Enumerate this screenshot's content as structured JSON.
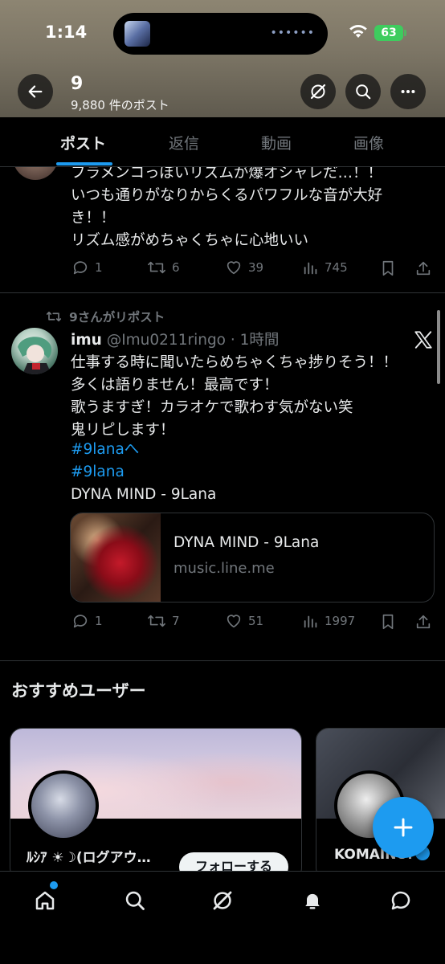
{
  "status_bar": {
    "time": "1:14",
    "battery": "63"
  },
  "header": {
    "name": "9",
    "post_count": "9,880 件のポスト"
  },
  "tabs": [
    {
      "label": "ポスト",
      "active": true
    },
    {
      "label": "返信",
      "active": false
    },
    {
      "label": "動画",
      "active": false
    },
    {
      "label": "画像",
      "active": false
    }
  ],
  "post1": {
    "text": "フラメンコっぽいリズムが爆オシャレだ…！！\nいつも通りがなりからくるパワフルな音が大好\nき！！\nリズム感がめちゃくちゃに心地いい",
    "replies": "1",
    "reposts": "6",
    "likes": "39",
    "views": "745"
  },
  "post2": {
    "repost_label": "9さんがリポスト",
    "author_name": "imu",
    "author_handle": "@Imu0211ringo · 1時間",
    "text": "仕事する時に聞いたらめちゃくちゃ捗りそう！！\n多くは語りません！最高です！\n歌うますぎ！カラオケで歌わす気がない笑\n鬼リピします！",
    "hashtags": [
      "#9lanaへ",
      "#9lana"
    ],
    "song_line": "DYNA MIND - 9Lana",
    "card": {
      "title": "DYNA MIND - 9Lana",
      "domain": "music.line.me"
    },
    "replies": "1",
    "reposts": "7",
    "likes": "51",
    "views": "1997"
  },
  "recommended": {
    "title": "おすすめユーザー",
    "users": [
      {
        "name": "ﾙｼｱ ☀︎☽(ログアウ…",
        "follow_label": "フォローする"
      },
      {
        "name": "KOMAINU."
      }
    ]
  },
  "colors": {
    "accent": "#1d9bf0",
    "muted": "#71767b",
    "text": "#e7e9ea",
    "border": "#2f3336"
  }
}
